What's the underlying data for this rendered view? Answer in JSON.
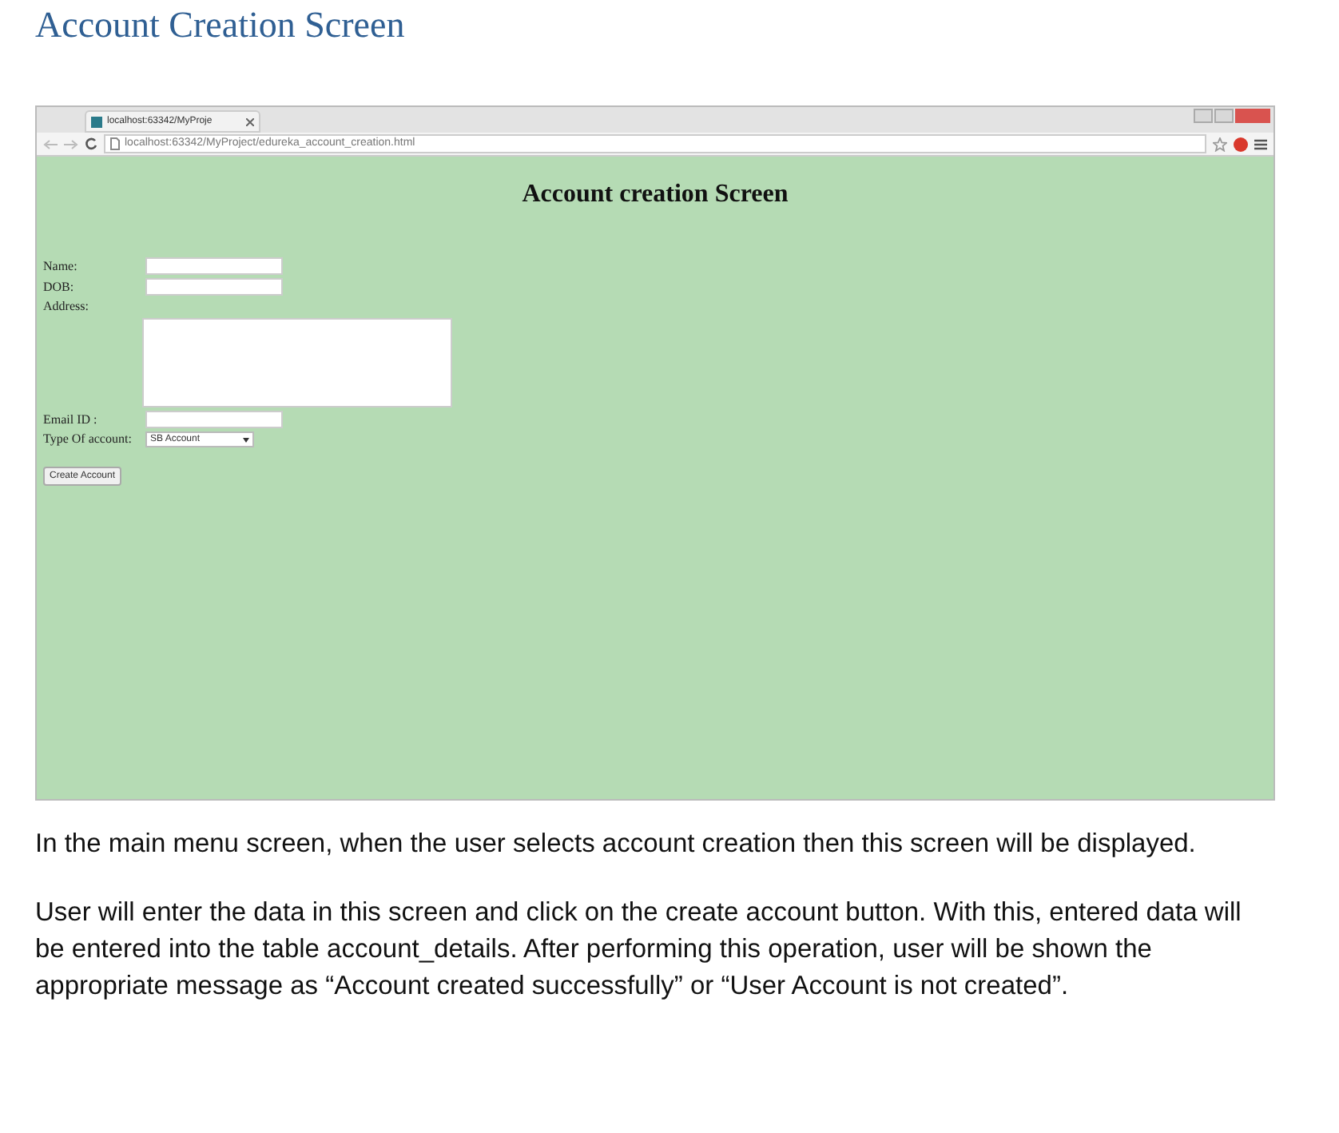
{
  "document_title": "Account Creation Screen",
  "browser": {
    "tab_title": "localhost:63342/MyProje",
    "url": "localhost:63342/MyProject/edureka_account_creation.html"
  },
  "page": {
    "heading": "Account creation Screen",
    "fields": [
      {
        "kind": "text",
        "label": "Name:"
      },
      {
        "kind": "text",
        "label": "DOB:"
      },
      {
        "kind": "textarea",
        "label": "Address:"
      },
      {
        "kind": "text",
        "label": "Email ID :"
      },
      {
        "kind": "select",
        "label": "Type Of account:",
        "value": "SB Account"
      }
    ],
    "button": "Create Account"
  },
  "paragraphs": [
    "In the main menu screen, when the user selects account creation then this screen will be displayed.",
    "User will enter the data in this screen and click on the create account button.  With this, entered data will be entered into the table account_details.  After performing this operation,  user will be shown the appropriate message as “Account created successfully” or “User Account is not created”."
  ]
}
